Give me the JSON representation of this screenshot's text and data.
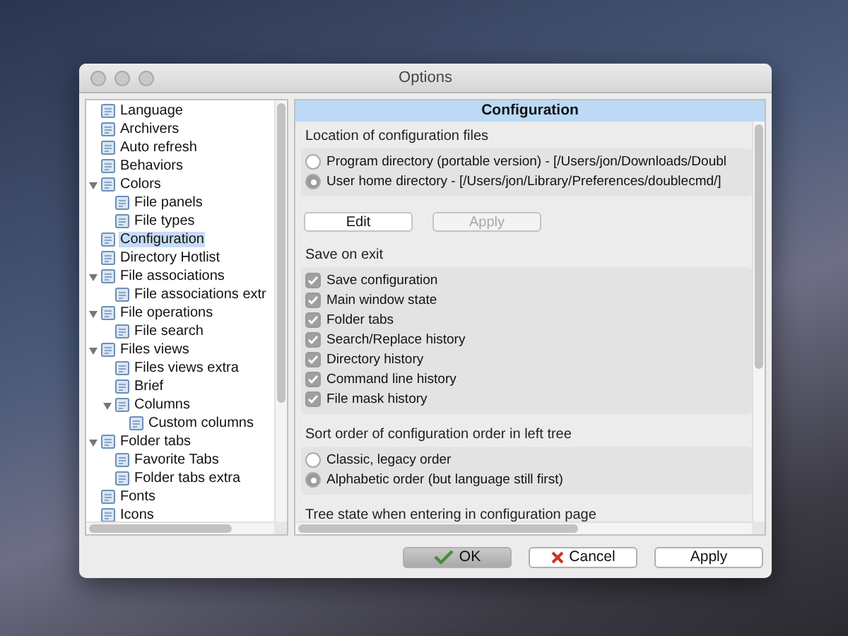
{
  "window": {
    "title": "Options"
  },
  "tree": {
    "items": [
      {
        "label": "Language",
        "selected": false
      },
      {
        "label": "Archivers",
        "selected": false
      },
      {
        "label": "Auto refresh",
        "selected": false
      },
      {
        "label": "Behaviors",
        "selected": false
      },
      {
        "label": "Colors",
        "selected": false,
        "expanded": true,
        "children": [
          {
            "label": "File panels",
            "selected": false
          },
          {
            "label": "File types",
            "selected": false
          }
        ]
      },
      {
        "label": "Configuration",
        "selected": true
      },
      {
        "label": "Directory Hotlist",
        "selected": false
      },
      {
        "label": "File associations",
        "selected": false,
        "expanded": true,
        "children": [
          {
            "label": "File associations extr",
            "selected": false
          }
        ]
      },
      {
        "label": "File operations",
        "selected": false,
        "expanded": true,
        "children": [
          {
            "label": "File search",
            "selected": false
          }
        ]
      },
      {
        "label": "Files views",
        "selected": false,
        "expanded": true,
        "children": [
          {
            "label": "Files views extra",
            "selected": false
          },
          {
            "label": "Brief",
            "selected": false
          },
          {
            "label": "Columns",
            "selected": false,
            "expanded": true,
            "children": [
              {
                "label": "Custom columns",
                "selected": false
              }
            ]
          }
        ]
      },
      {
        "label": "Folder tabs",
        "selected": false,
        "expanded": true,
        "children": [
          {
            "label": "Favorite Tabs",
            "selected": false
          },
          {
            "label": "Folder tabs extra",
            "selected": false
          }
        ]
      },
      {
        "label": "Fonts",
        "selected": false
      },
      {
        "label": "Icons",
        "selected": false
      }
    ]
  },
  "page": {
    "title": "Configuration",
    "location": {
      "label": "Location of configuration files",
      "options": [
        {
          "label": "Program directory (portable version) - [/Users/jon/Downloads/Doubl",
          "selected": false
        },
        {
          "label": "User home directory - [/Users/jon/Library/Preferences/doublecmd/]",
          "selected": true
        }
      ]
    },
    "buttons": [
      {
        "label": "Edit",
        "disabled": false
      },
      {
        "label": "Apply",
        "disabled": true
      }
    ],
    "save_on_exit": {
      "label": "Save on exit",
      "options": [
        {
          "label": "Save configuration",
          "checked": true
        },
        {
          "label": "Main window state",
          "checked": true
        },
        {
          "label": "Folder tabs",
          "checked": true
        },
        {
          "label": "Search/Replace history",
          "checked": true
        },
        {
          "label": "Directory history",
          "checked": true
        },
        {
          "label": "Command line history",
          "checked": true
        },
        {
          "label": "File mask history",
          "checked": true
        }
      ]
    },
    "sort_order": {
      "label": "Sort order of configuration order in left tree",
      "options": [
        {
          "label": "Classic, legacy order",
          "selected": false
        },
        {
          "label": "Alphabetic order (but language still first)",
          "selected": true
        }
      ]
    },
    "tree_state": {
      "label": "Tree state when entering in configuration page"
    }
  },
  "dialog_buttons": [
    {
      "label": "OK",
      "kind": "ok"
    },
    {
      "label": "Cancel",
      "kind": "cancel"
    },
    {
      "label": "Apply",
      "kind": "apply"
    }
  ]
}
